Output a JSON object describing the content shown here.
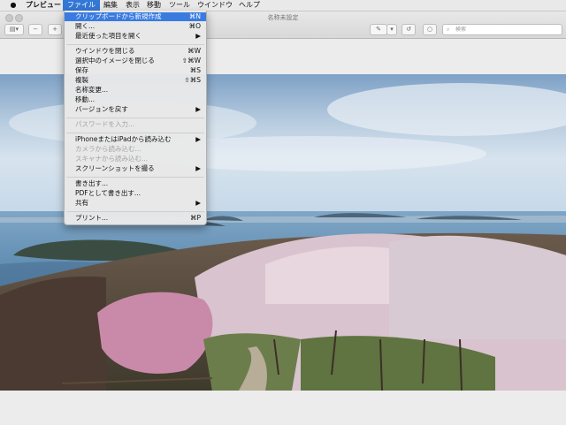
{
  "menubar": {
    "items": [
      "プレビュー",
      "ファイル",
      "編集",
      "表示",
      "移動",
      "ツール",
      "ウインドウ",
      "ヘルプ"
    ]
  },
  "window": {
    "title": "名称未設定"
  },
  "toolbar": {
    "search_placeholder": "検索"
  },
  "file_menu": {
    "items": [
      {
        "label": "クリップボードから新規作成",
        "shortcut": "⌘N",
        "state": "highlighted"
      },
      {
        "label": "開く...",
        "shortcut": "⌘O",
        "state": "enabled"
      },
      {
        "label": "最近使った項目を開く",
        "shortcut": "▶",
        "state": "enabled"
      },
      {
        "label": "ウインドウを閉じる",
        "shortcut": "⌘W",
        "state": "enabled"
      },
      {
        "label": "選択中のイメージを閉じる",
        "shortcut": "⇧⌘W",
        "state": "enabled"
      },
      {
        "label": "保存",
        "shortcut": "⌘S",
        "state": "enabled"
      },
      {
        "label": "複製",
        "shortcut": "⇧⌘S",
        "state": "enabled"
      },
      {
        "label": "名称変更...",
        "shortcut": "",
        "state": "enabled"
      },
      {
        "label": "移動...",
        "shortcut": "",
        "state": "enabled"
      },
      {
        "label": "バージョンを戻す",
        "shortcut": "▶",
        "state": "enabled"
      },
      {
        "label": "パスワードを入力...",
        "shortcut": "",
        "state": "disabled"
      },
      {
        "label": "iPhoneまたはiPadから読み込む",
        "shortcut": "▶",
        "state": "enabled"
      },
      {
        "label": "カメラから読み込む...",
        "shortcut": "",
        "state": "disabled"
      },
      {
        "label": "スキャナから読み込む...",
        "shortcut": "",
        "state": "disabled"
      },
      {
        "label": "スクリーンショットを撮る",
        "shortcut": "▶",
        "state": "enabled"
      },
      {
        "label": "書き出す...",
        "shortcut": "",
        "state": "enabled"
      },
      {
        "label": "PDFとして書き出す...",
        "shortcut": "",
        "state": "enabled"
      },
      {
        "label": "共有",
        "shortcut": "▶",
        "state": "enabled"
      },
      {
        "label": "プリント...",
        "shortcut": "⌘P",
        "state": "enabled"
      }
    ]
  },
  "colors": {
    "highlight": "#3a7be0",
    "menubar_active": "#3478d6"
  }
}
